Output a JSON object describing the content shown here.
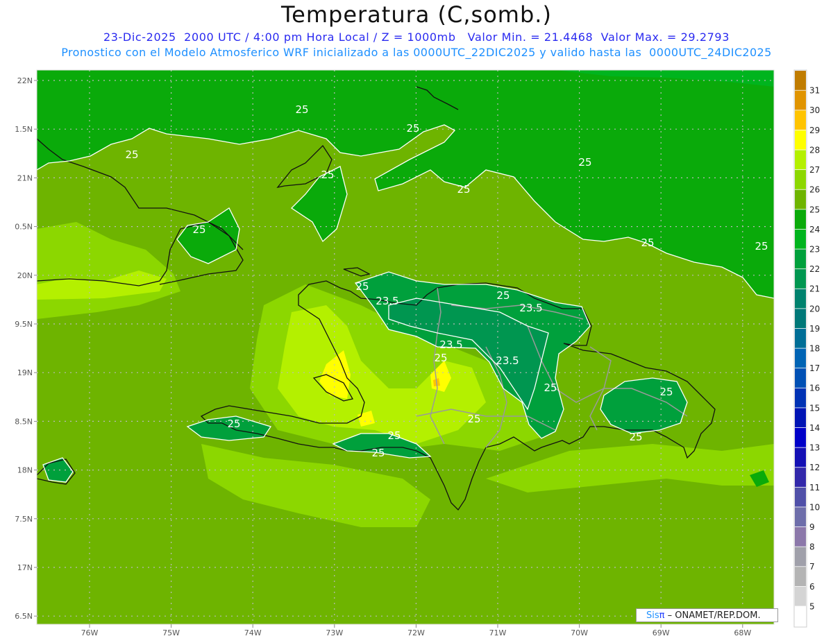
{
  "header": {
    "title": "Temperatura (C,somb.)",
    "line1": "23-Dic-2025  2000 UTC / 4:00 pm Hora Local / Z = 1000mb   Valor Min. = 21.4468  Valor Max. = 29.2793",
    "line2": "Pronostico con el Modelo Atmosferico WRF inicializado a las 0000UTC_22DIC2025 y valido hasta las  0000UTC_24DIC2025"
  },
  "axes": {
    "lat_labels": [
      "22N",
      "1.5N",
      "21N",
      "0.5N",
      "20N",
      "9.5N",
      "19N",
      "8.5N",
      "18N",
      "7.5N",
      "17N",
      "6.5N"
    ],
    "lon_labels": [
      "76W",
      "75W",
      "74W",
      "73W",
      "72W",
      "71W",
      "70W",
      "69W",
      "68W"
    ]
  },
  "colorbar": {
    "labels": [
      "31",
      "30",
      "29",
      "28",
      "27",
      "26",
      "25",
      "24",
      "23",
      "22",
      "21",
      "20",
      "19",
      "18",
      "17",
      "16",
      "15",
      "14",
      "13",
      "12",
      "11",
      "10",
      "9",
      "8",
      "7",
      "6",
      "5"
    ],
    "colors": [
      "#c07c00",
      "#e09400",
      "#ffc400",
      "#ffff00",
      "#b4f000",
      "#8cd700",
      "#6eb400",
      "#0aaa0a",
      "#00b41e",
      "#00a03c",
      "#009650",
      "#00826e",
      "#007878",
      "#006e96",
      "#0064b4",
      "#0050b4",
      "#0032b4",
      "#0014b4",
      "#0000c8",
      "#1410b4",
      "#3228aa",
      "#5050a8",
      "#6e6eaa",
      "#8c78aa",
      "#a0a0aa",
      "#b4b4b4",
      "#d4d4d4",
      "#ffffff"
    ]
  },
  "contour_labels": [
    "25",
    "25",
    "25",
    "25",
    "25",
    "25",
    "25",
    "25",
    "25",
    "25",
    "23.5",
    "25",
    "23.5",
    "23.5",
    "25",
    "23.5",
    "25",
    "25",
    "25",
    "25",
    "25",
    "25",
    "25"
  ],
  "credit": {
    "sis": "Sis",
    "pi": "π",
    "org": " – ONAMET/REP.DOM."
  },
  "colors": {
    "base": "#6eb400",
    "sea_north": "#0aaa0a",
    "light": "#8cd700",
    "yellowgreen": "#b4f000",
    "yellow": "#ffff00",
    "land_dark": "#00a03c",
    "land_darker": "#009650"
  }
}
